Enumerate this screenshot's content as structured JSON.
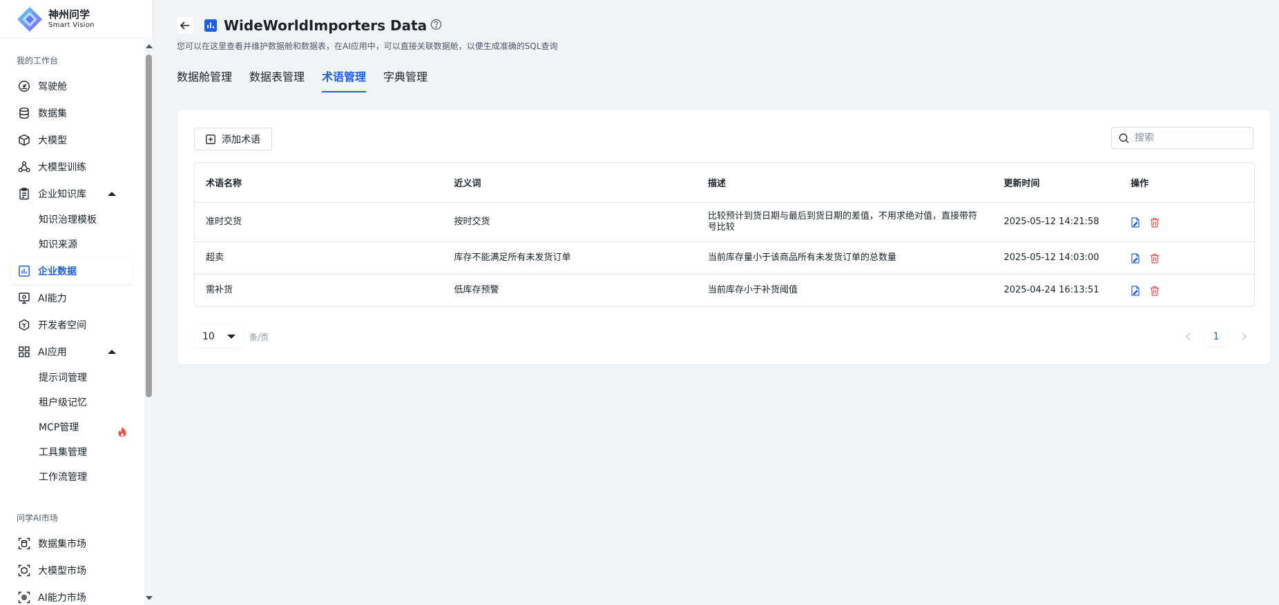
{
  "brand": {
    "name_cn": "神州问学",
    "name_en": "Smart Vision"
  },
  "sidebar": {
    "group1": "我的工作台",
    "items": [
      {
        "label": "驾驶舱",
        "icon": "dashboard-icon"
      },
      {
        "label": "数据集",
        "icon": "database-icon"
      },
      {
        "label": "大模型",
        "icon": "cube-icon"
      },
      {
        "label": "大模型训练",
        "icon": "training-icon"
      },
      {
        "label": "企业知识库",
        "icon": "clipboard-icon"
      },
      {
        "label": "知识治理模板"
      },
      {
        "label": "知识来源"
      },
      {
        "label": "企业数据",
        "icon": "chart-icon"
      },
      {
        "label": "AI能力",
        "icon": "monitor-icon"
      },
      {
        "label": "开发者空间",
        "icon": "developer-icon"
      },
      {
        "label": "AI应用",
        "icon": "grid-icon"
      },
      {
        "label": "提示词管理"
      },
      {
        "label": "租户级记忆"
      },
      {
        "label": "MCP管理"
      },
      {
        "label": "工具集管理"
      },
      {
        "label": "工作流管理"
      }
    ],
    "group2": "问学AI市场",
    "market": [
      {
        "label": "数据集市场",
        "icon": "dataset-market-icon"
      },
      {
        "label": "大模型市场",
        "icon": "model-market-icon"
      },
      {
        "label": "AI能力市场",
        "icon": "ai-market-icon"
      }
    ]
  },
  "header": {
    "title": "WideWorldImporters Data",
    "subtitle": "您可以在这里查看并维护数据舱和数据表，在AI应用中，可以直接关联数据舱，以便生成准确的SQL查询"
  },
  "tabs": [
    "数据舱管理",
    "数据表管理",
    "术语管理",
    "字典管理"
  ],
  "toolbar": {
    "add_label": "添加术语",
    "search_placeholder": "搜索"
  },
  "table": {
    "headers": [
      "术语名称",
      "近义词",
      "描述",
      "更新时间",
      "操作"
    ],
    "rows": [
      {
        "name": "准时交货",
        "synonym": "按时交货",
        "desc": "比较预计到货日期与最后到货日期的差值，不用求绝对值，直接带符号比较",
        "time": "2025-05-12 14:21:58"
      },
      {
        "name": "超卖",
        "synonym": "库存不能满足所有未发货订单",
        "desc": "当前库存量小于该商品所有未发货订单的总数量",
        "time": "2025-05-12 14:03:00"
      },
      {
        "name": "需补货",
        "synonym": "低库存预警",
        "desc": "当前库存小于补货阈值",
        "time": "2025-04-24 16:13:51"
      }
    ]
  },
  "pagination": {
    "page_size": "10",
    "per_page_label": "条/页",
    "current_page": "1"
  },
  "colors": {
    "accent": "#1f5fdb",
    "danger": "#f04b4b",
    "fire": "#f04b4b"
  }
}
